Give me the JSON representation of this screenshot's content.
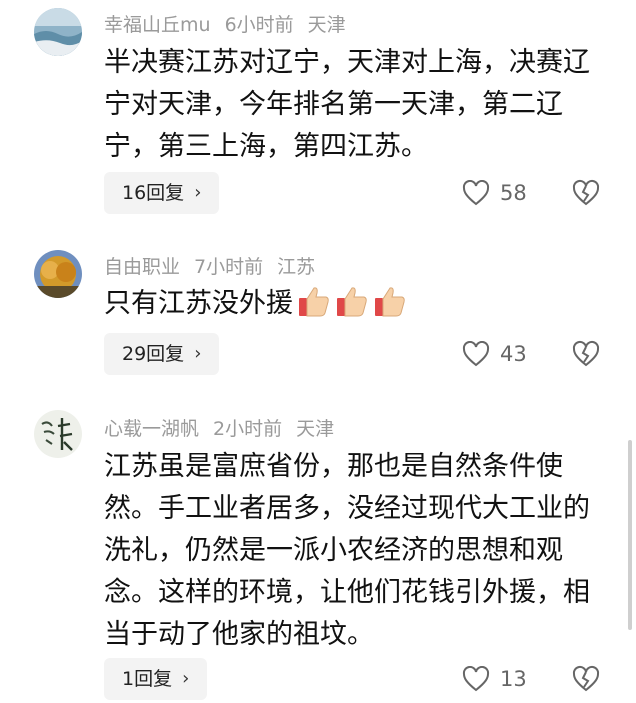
{
  "comments": [
    {
      "username": "幸福山丘mu",
      "time": "6小时前",
      "location": "天津",
      "text": "半决赛江苏对辽宁，天津对上海，决赛辽宁对天津，今年排名第一天津，第二辽宁，第三上海，第四江苏。",
      "reply_label": "16回复",
      "likes": "58"
    },
    {
      "username": "自由职业",
      "time": "7小时前",
      "location": "江苏",
      "text": "只有江苏没外援",
      "emoji": "thumbs-up-icon x3",
      "reply_label": "29回复",
      "likes": "43"
    },
    {
      "username": "心载一湖帆",
      "time": "2小时前",
      "location": "天津",
      "text": "江苏虽是富庶省份，那也是自然条件使然。手工业者居多，没经过现代大工业的洗礼，仍然是一派小农经济的思想和观念。这样的环境，让他们花钱引外援，相当于动了他家的祖坟。",
      "reply_label": "1回复",
      "likes": "13"
    }
  ],
  "icons": {
    "reply_chevron": "›",
    "like": "heart-outline-icon",
    "dislike": "broken-heart-icon"
  }
}
